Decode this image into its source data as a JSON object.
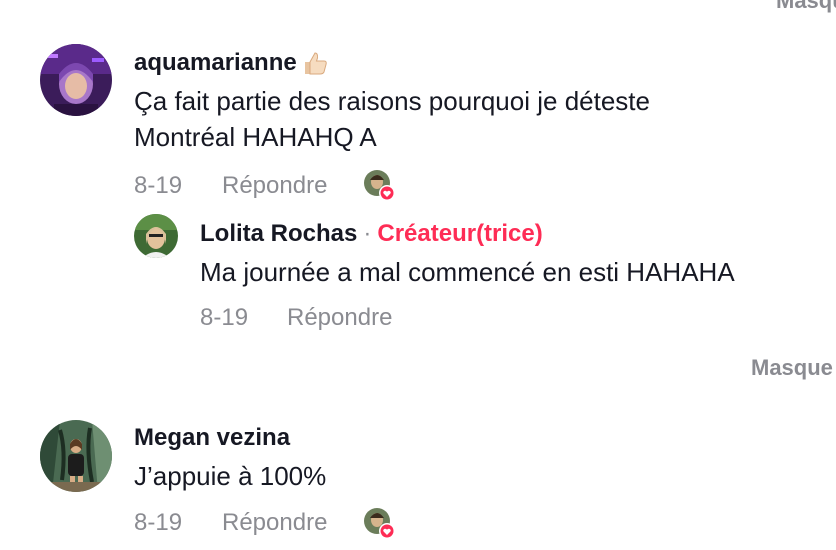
{
  "top_fragment": "Masque",
  "comments": [
    {
      "username": "aquamarianne",
      "has_emoji": "thumbs-up-icon",
      "text_line1": "Ça fait partie des raisons pourquoi je déteste",
      "text_line2": "Montréal HAHAHQ A",
      "date": "8-19",
      "reply_label": "Répondre"
    },
    {
      "username": "Lolita Rochas",
      "separator": "·",
      "creator_badge": "Créateur(trice)",
      "text_line1": "Ma journée a mal commencé en esti HAHAHA",
      "date": "8-19",
      "reply_label": "Répondre"
    },
    {
      "username": "Megan vezina",
      "text_line1": "J’appuie à 100%",
      "date": "8-19",
      "reply_label": "Répondre"
    }
  ],
  "hide_replies_label": "Masque",
  "colors": {
    "text": "#161823",
    "muted": "#8a8b91",
    "accent": "#fe2c55"
  }
}
